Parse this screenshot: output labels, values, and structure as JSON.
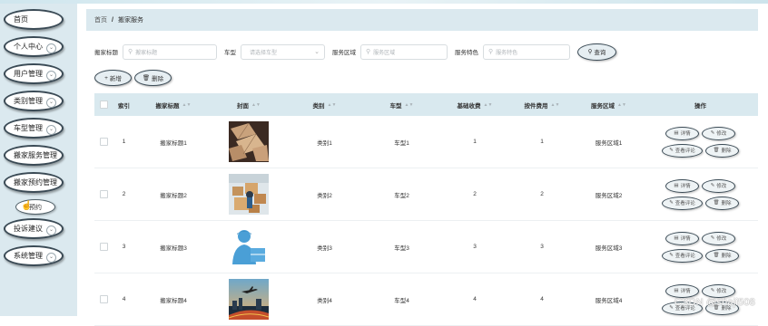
{
  "sidebar": {
    "items": [
      {
        "label": "首页",
        "has_chevron": false
      },
      {
        "label": "个人中心",
        "has_chevron": true
      },
      {
        "label": "用户管理",
        "has_chevron": true
      },
      {
        "label": "类别管理",
        "has_chevron": true
      },
      {
        "label": "车型管理",
        "has_chevron": true
      },
      {
        "label": "搬家服务管理",
        "has_chevron": false
      },
      {
        "label": "搬家预约管理",
        "has_chevron": false
      },
      {
        "label": "投诉建议",
        "has_chevron": true
      },
      {
        "label": "系统管理",
        "has_chevron": true
      }
    ],
    "sub_item": {
      "label": "预约"
    }
  },
  "breadcrumb": {
    "home": "首页",
    "separator": "/",
    "current": "搬家服务"
  },
  "filters": {
    "title": {
      "label": "搬家标题",
      "placeholder": "搬家标题"
    },
    "car_type": {
      "label": "车型",
      "placeholder": "请选择车型"
    },
    "area": {
      "label": "服务区域",
      "placeholder": "服务区域"
    },
    "feature": {
      "label": "服务特色",
      "placeholder": "服务特色"
    },
    "search_button": "查询"
  },
  "actions": {
    "add": "新增",
    "delete": "删除"
  },
  "table": {
    "headers": [
      "索引",
      "搬家标题",
      "封面",
      "类别",
      "车型",
      "基础收费",
      "按件费用",
      "服务区域",
      "操作"
    ],
    "rows": [
      {
        "index": "1",
        "title": "搬家标题1",
        "category": "类别1",
        "car": "车型1",
        "base": "1",
        "piece": "1",
        "area": "服务区域1",
        "cover": "cardboard-boxes"
      },
      {
        "index": "2",
        "title": "搬家标题2",
        "category": "类别2",
        "car": "车型2",
        "base": "2",
        "piece": "2",
        "area": "服务区域2",
        "cover": "warehouse-boxes"
      },
      {
        "index": "3",
        "title": "搬家标题3",
        "category": "类别3",
        "car": "车型3",
        "base": "3",
        "piece": "3",
        "area": "服务区域3",
        "cover": "delivery-person-icon"
      },
      {
        "index": "4",
        "title": "搬家标题4",
        "category": "类别4",
        "car": "车型4",
        "base": "4",
        "piece": "4",
        "area": "服务区域4",
        "cover": "airplane-city"
      }
    ],
    "row_actions": {
      "detail": "详情",
      "edit": "修改",
      "review": "查看评论",
      "delete": "删除"
    }
  },
  "watermark": "CSDN @shaji508",
  "colors": {
    "sidebar_bg": "#dbe9ef",
    "header_bg": "#d9e9ef",
    "button_border": "#3a4a55"
  }
}
